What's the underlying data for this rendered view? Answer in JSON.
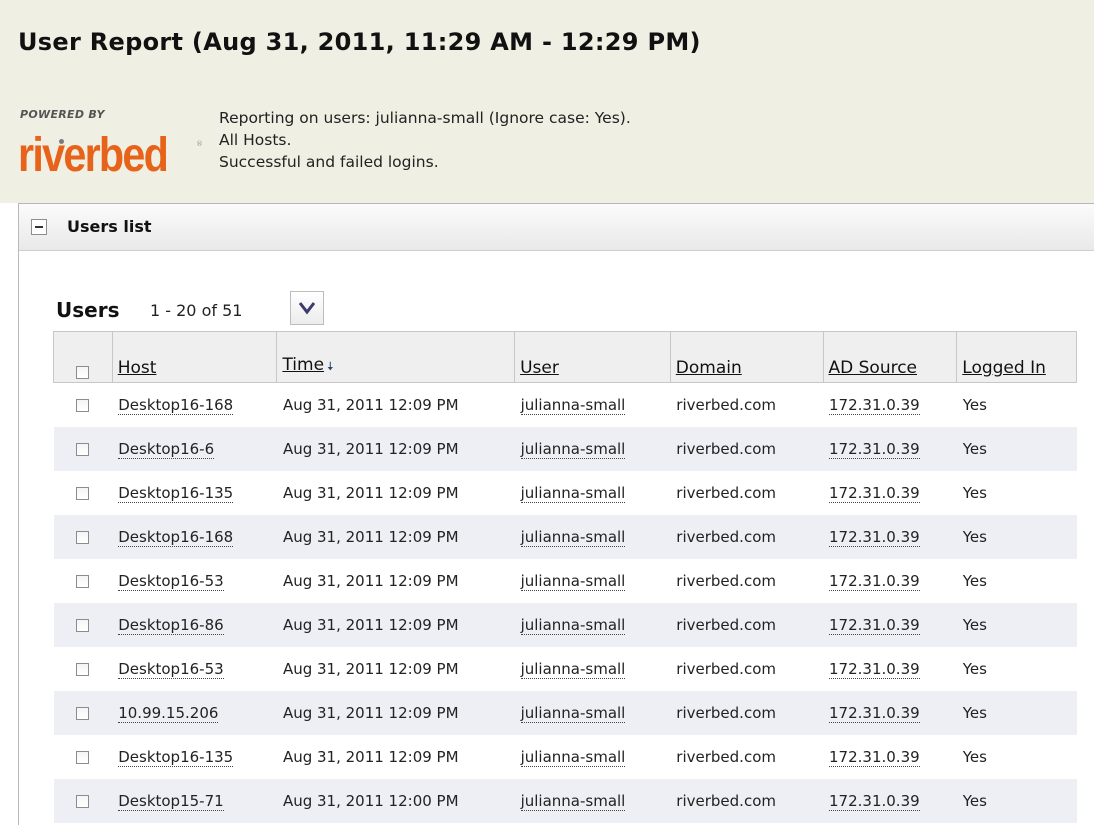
{
  "report": {
    "title": "User Report (Aug 31, 2011, 11:29 AM - 12:29 PM)",
    "powered_by": "POWERED BY",
    "logo_text": "riverbed",
    "info_lines": [
      "Reporting on users: julianna-small (Ignore case: Yes).",
      "All Hosts.",
      "Successful and failed logins."
    ]
  },
  "panel": {
    "title": "Users list",
    "collapse_icon": "minus-icon"
  },
  "users": {
    "title": "Users",
    "range": "1 - 20 of 51",
    "dropdown_icon": "chevron-down-icon",
    "columns": [
      "Host",
      "Time",
      "User",
      "Domain",
      "AD Source",
      "Logged In"
    ],
    "sort_column": "Time",
    "sort_direction": "descending",
    "rows": [
      {
        "host": "Desktop16-168",
        "time": "Aug 31, 2011 12:09 PM",
        "user": "julianna-small",
        "domain": "riverbed.com",
        "ad_source": "172.31.0.39",
        "logged_in": "Yes"
      },
      {
        "host": "Desktop16-6",
        "time": "Aug 31, 2011 12:09 PM",
        "user": "julianna-small",
        "domain": "riverbed.com",
        "ad_source": "172.31.0.39",
        "logged_in": "Yes"
      },
      {
        "host": "Desktop16-135",
        "time": "Aug 31, 2011 12:09 PM",
        "user": "julianna-small",
        "domain": "riverbed.com",
        "ad_source": "172.31.0.39",
        "logged_in": "Yes"
      },
      {
        "host": "Desktop16-168",
        "time": "Aug 31, 2011 12:09 PM",
        "user": "julianna-small",
        "domain": "riverbed.com",
        "ad_source": "172.31.0.39",
        "logged_in": "Yes"
      },
      {
        "host": "Desktop16-53",
        "time": "Aug 31, 2011 12:09 PM",
        "user": "julianna-small",
        "domain": "riverbed.com",
        "ad_source": "172.31.0.39",
        "logged_in": "Yes"
      },
      {
        "host": "Desktop16-86",
        "time": "Aug 31, 2011 12:09 PM",
        "user": "julianna-small",
        "domain": "riverbed.com",
        "ad_source": "172.31.0.39",
        "logged_in": "Yes"
      },
      {
        "host": "Desktop16-53",
        "time": "Aug 31, 2011 12:09 PM",
        "user": "julianna-small",
        "domain": "riverbed.com",
        "ad_source": "172.31.0.39",
        "logged_in": "Yes"
      },
      {
        "host": "10.99.15.206",
        "time": "Aug 31, 2011 12:09 PM",
        "user": "julianna-small",
        "domain": "riverbed.com",
        "ad_source": "172.31.0.39",
        "logged_in": "Yes"
      },
      {
        "host": "Desktop16-135",
        "time": "Aug 31, 2011 12:09 PM",
        "user": "julianna-small",
        "domain": "riverbed.com",
        "ad_source": "172.31.0.39",
        "logged_in": "Yes"
      },
      {
        "host": "Desktop15-71",
        "time": "Aug 31, 2011 12:00 PM",
        "user": "julianna-small",
        "domain": "riverbed.com",
        "ad_source": "172.31.0.39",
        "logged_in": "Yes"
      }
    ]
  },
  "colors": {
    "header_bg": "#efefe4",
    "brand_orange": "#e8631a",
    "row_alt": "#eeeef5"
  }
}
